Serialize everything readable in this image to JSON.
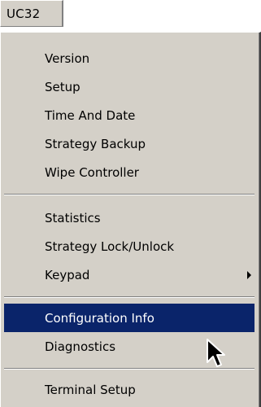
{
  "menubar": {
    "label": "UC32"
  },
  "menu": {
    "items": [
      {
        "label": "Version"
      },
      {
        "label": "Setup"
      },
      {
        "label": "Time And Date"
      },
      {
        "label": "Strategy Backup"
      },
      {
        "label": "Wipe Controller"
      },
      {
        "label": "Statistics"
      },
      {
        "label": "Strategy Lock/Unlock"
      },
      {
        "label": "Keypad",
        "submenu": true
      },
      {
        "label": "Configuration Info",
        "highlighted": true
      },
      {
        "label": "Diagnostics"
      },
      {
        "label": "Terminal Setup"
      }
    ]
  },
  "icons": {
    "submenu_arrow": "triangle-right",
    "cursor": "arrow-pointer"
  },
  "colors": {
    "menu_bg": "#d4d0c8",
    "highlight": "#0a246a",
    "highlight_text": "#ffffff"
  }
}
